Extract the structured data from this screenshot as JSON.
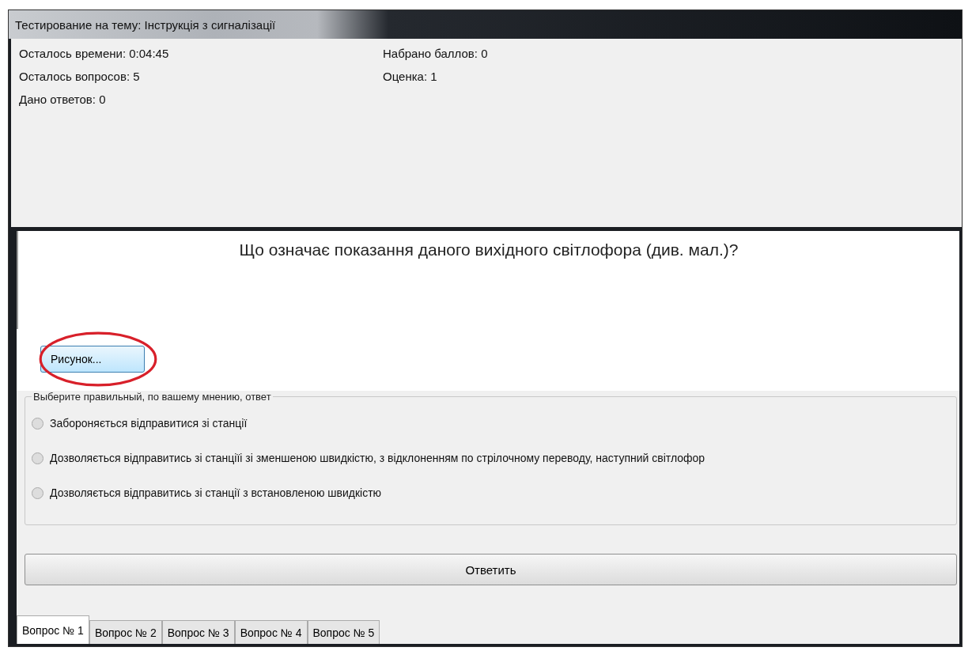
{
  "window": {
    "title": "Тестирование на тему: Інструкція з сигналізації"
  },
  "stats": [
    {
      "label": "Осталось времени:",
      "value": "0:04:45"
    },
    {
      "label": "Набрано баллов:",
      "value": "0"
    },
    {
      "label": "Осталось вопросов:",
      "value": "5"
    },
    {
      "label": "Оценка:",
      "value": "1"
    },
    {
      "label": "Дано ответов:",
      "value": "0"
    }
  ],
  "question": "Що означає показання даного вихідного світлофора (див. мал.)?",
  "picture_button": {
    "label": "Рисунок...",
    "highlighted": true
  },
  "answers_group": {
    "title": "Выберите правильный, по вашему мнению, ответ",
    "options": [
      {
        "label": "Забороняється відправитися зі станції",
        "selected": false
      },
      {
        "label": "Дозволяється відправитись зі станціїі зі зменшеною швидкістю, з відклоненням по стрілочному переводу, наступний світлофор",
        "selected": false
      },
      {
        "label": "Дозволяється відправитись зі станції з встановленою швидкістю",
        "selected": false
      }
    ]
  },
  "answer_button": "Ответить",
  "tabs": [
    {
      "label": "Вопрос № 1",
      "selected": true
    },
    {
      "label": "Вопрос № 2",
      "selected": false
    },
    {
      "label": "Вопрос № 3",
      "selected": false
    },
    {
      "label": "Вопрос № 4",
      "selected": false
    },
    {
      "label": "Вопрос № 5",
      "selected": false
    }
  ]
}
